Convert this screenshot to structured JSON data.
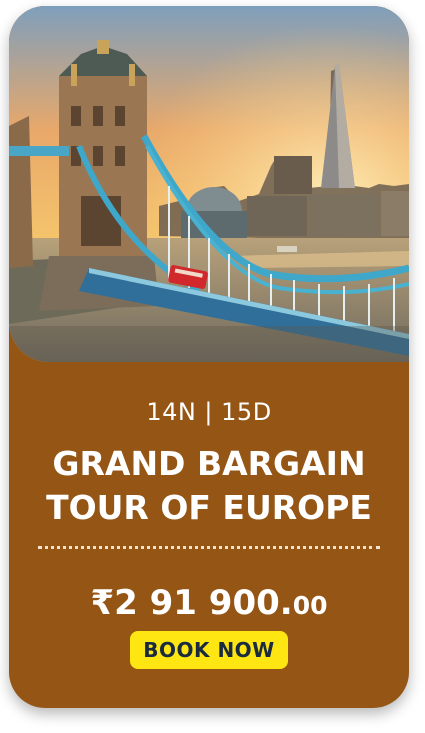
{
  "package": {
    "duration": "14N | 15D",
    "title_line1": "GRAND BARGAIN",
    "title_line2": "TOUR OF EUROPE",
    "price_main": "₹2 91 900.",
    "price_decimal": "00",
    "book_label": "BOOK NOW"
  },
  "colors": {
    "card_background": "#955515",
    "button_background": "#fde611",
    "button_text": "#1a2a3f",
    "text": "#ffffff"
  }
}
